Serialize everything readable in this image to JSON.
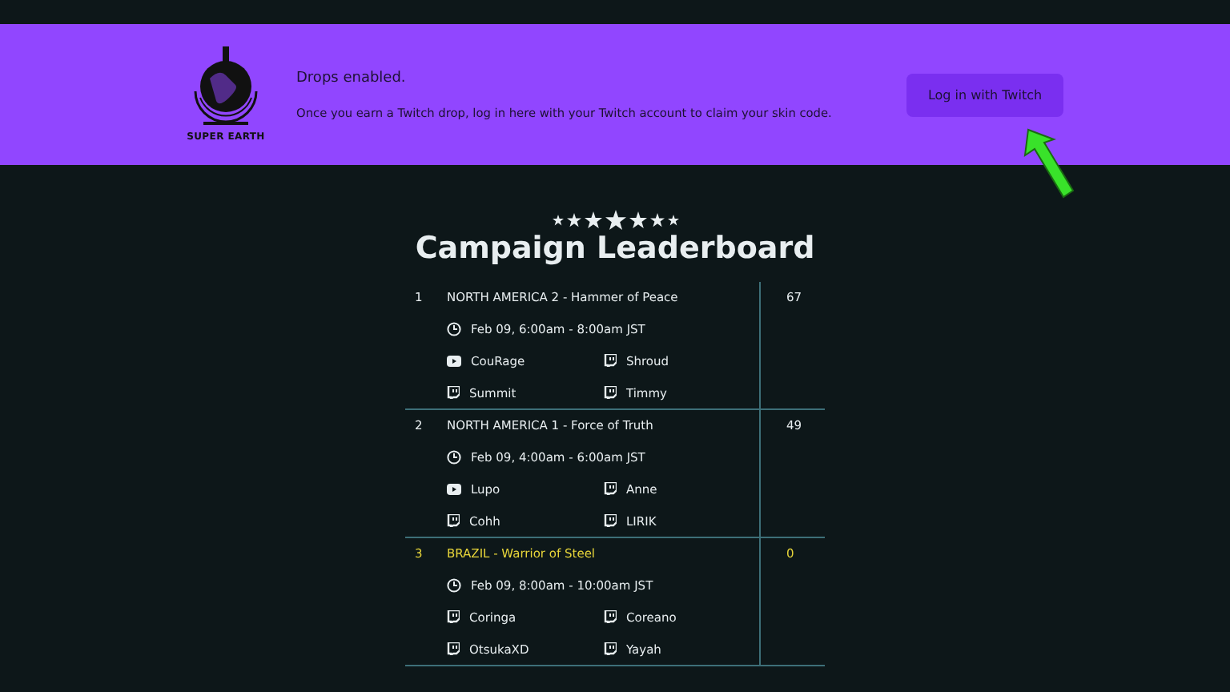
{
  "banner": {
    "logo_text": "SUPER EARTH",
    "heading": "Drops enabled.",
    "message": "Once you earn a Twitch drop, log in here with your Twitch account to claim your skin code.",
    "button": "Log in with Twitch"
  },
  "leaderboard": {
    "title": "Campaign Leaderboard",
    "stars": 7,
    "rows": [
      {
        "rank": "1",
        "name": "NORTH AMERICA 2 - Hammer of Peace",
        "score": "67",
        "highlighted": false,
        "time": "Feb 09, 6:00am - 8:00am JST",
        "streamers": [
          {
            "name": "CouRage",
            "kind": "youtube"
          },
          {
            "name": "Shroud",
            "kind": "twitch"
          },
          {
            "name": "Summit",
            "kind": "twitch"
          },
          {
            "name": "Timmy",
            "kind": "twitch"
          }
        ]
      },
      {
        "rank": "2",
        "name": "NORTH AMERICA 1 - Force of Truth",
        "score": "49",
        "highlighted": false,
        "time": "Feb 09, 4:00am - 6:00am JST",
        "streamers": [
          {
            "name": "Lupo",
            "kind": "youtube"
          },
          {
            "name": "Anne",
            "kind": "twitch"
          },
          {
            "name": "Cohh",
            "kind": "twitch"
          },
          {
            "name": "LIRIK",
            "kind": "twitch"
          }
        ]
      },
      {
        "rank": "3",
        "name": "BRAZIL - Warrior of Steel",
        "score": "0",
        "highlighted": true,
        "time": "Feb 09, 8:00am - 10:00am JST",
        "streamers": [
          {
            "name": "Coringa",
            "kind": "twitch"
          },
          {
            "name": "Coreano",
            "kind": "twitch"
          },
          {
            "name": "OtsukaXD",
            "kind": "twitch"
          },
          {
            "name": "Yayah",
            "kind": "twitch"
          }
        ]
      }
    ]
  }
}
